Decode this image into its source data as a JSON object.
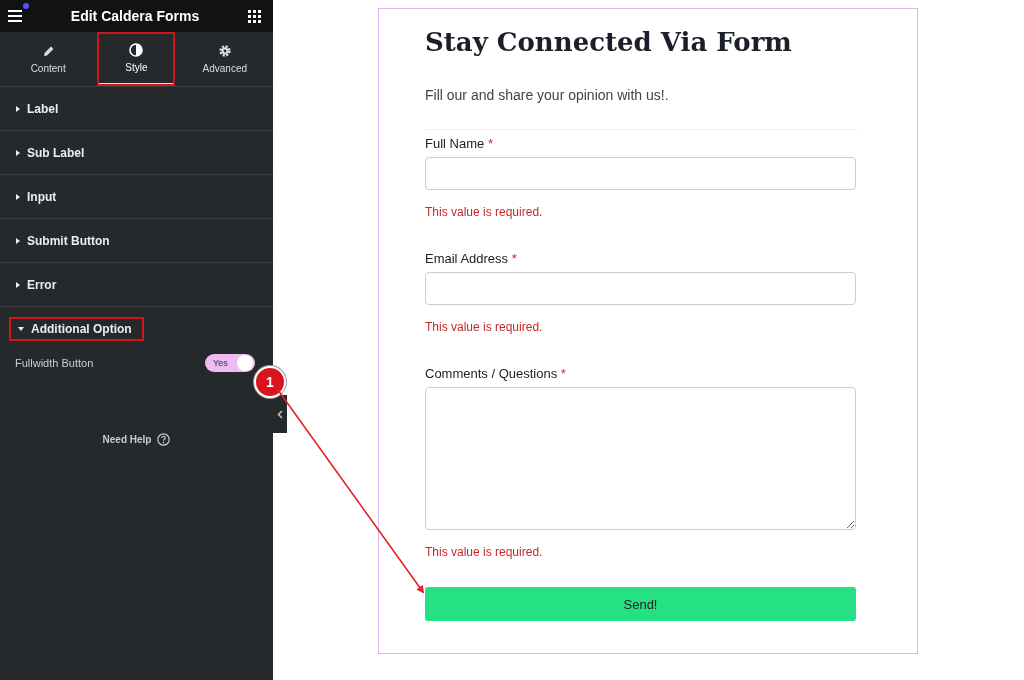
{
  "panel": {
    "title": "Edit Caldera Forms",
    "tabs": [
      {
        "label": "Content",
        "selected": false,
        "highlighted": false
      },
      {
        "label": "Style",
        "selected": true,
        "highlighted": true
      },
      {
        "label": "Advanced",
        "selected": false,
        "highlighted": false
      }
    ],
    "sections": [
      {
        "label": "Label",
        "expanded": false,
        "highlighted": false
      },
      {
        "label": "Sub Label",
        "expanded": false,
        "highlighted": false
      },
      {
        "label": "Input",
        "expanded": false,
        "highlighted": false
      },
      {
        "label": "Submit Button",
        "expanded": false,
        "highlighted": false
      },
      {
        "label": "Error",
        "expanded": false,
        "highlighted": false
      },
      {
        "label": "Additional Option",
        "expanded": true,
        "highlighted": true,
        "controls": [
          {
            "label": "Fullwidth Button",
            "kind": "switch",
            "on": true,
            "value": "Yes"
          }
        ]
      }
    ],
    "help": "Need Help"
  },
  "annotation": {
    "badge": "1"
  },
  "form": {
    "title": "Stay Connected Via Form",
    "intro": "Fill our and share your opinion with us!.",
    "fields": [
      {
        "label": "Full Name",
        "required_mark": "*",
        "kind": "text",
        "error": "This value is required."
      },
      {
        "label": "Email Address",
        "required_mark": "*",
        "kind": "text",
        "error": "This value is required."
      },
      {
        "label": "Comments / Questions",
        "required_mark": "*",
        "kind": "textarea",
        "error": "This value is required."
      }
    ],
    "submit": {
      "label": "Send!",
      "fullwidth": true
    }
  }
}
